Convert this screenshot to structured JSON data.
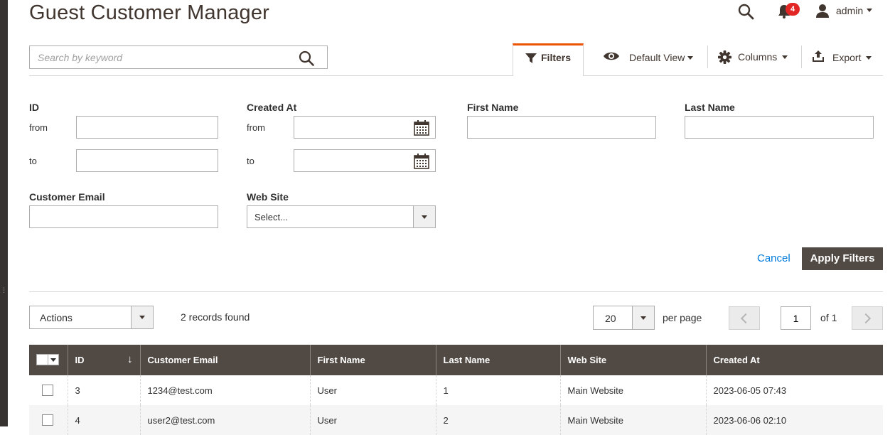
{
  "page": {
    "title": "Guest Customer Manager"
  },
  "header": {
    "notifications_count": "4",
    "user_name": "admin"
  },
  "search": {
    "placeholder": "Search by keyword"
  },
  "toolbar": {
    "filters_label": "Filters",
    "view_label": "Default View",
    "columns_label": "Columns",
    "export_label": "Export"
  },
  "filters": {
    "id_label": "ID",
    "created_at_label": "Created At",
    "first_name_label": "First Name",
    "last_name_label": "Last Name",
    "customer_email_label": "Customer Email",
    "website_label": "Web Site",
    "from_label": "from",
    "to_label": "to",
    "website_value": "Select...",
    "cancel_label": "Cancel",
    "apply_label": "Apply Filters"
  },
  "listing": {
    "actions_label": "Actions",
    "records_found": "2 records found",
    "per_page_value": "20",
    "per_page_label": "per page",
    "current_page": "1",
    "of_pages": "of 1"
  },
  "grid": {
    "columns": [
      "ID",
      "Customer Email",
      "First Name",
      "Last Name",
      "Web Site",
      "Created At"
    ],
    "sort_indicator": "↓",
    "rows": [
      {
        "id": "3",
        "email": "1234@test.com",
        "first_name": "User",
        "last_name": "1",
        "website": "Main Website",
        "created_at": "2023-06-05 07:43"
      },
      {
        "id": "4",
        "email": "user2@test.com",
        "first_name": "User",
        "last_name": "2",
        "website": "Main Website",
        "created_at": "2023-06-06 02:10"
      }
    ]
  },
  "colors": {
    "accent": "#eb5202",
    "header_bg": "#514943",
    "link": "#007bdb",
    "badge": "#e22626"
  }
}
